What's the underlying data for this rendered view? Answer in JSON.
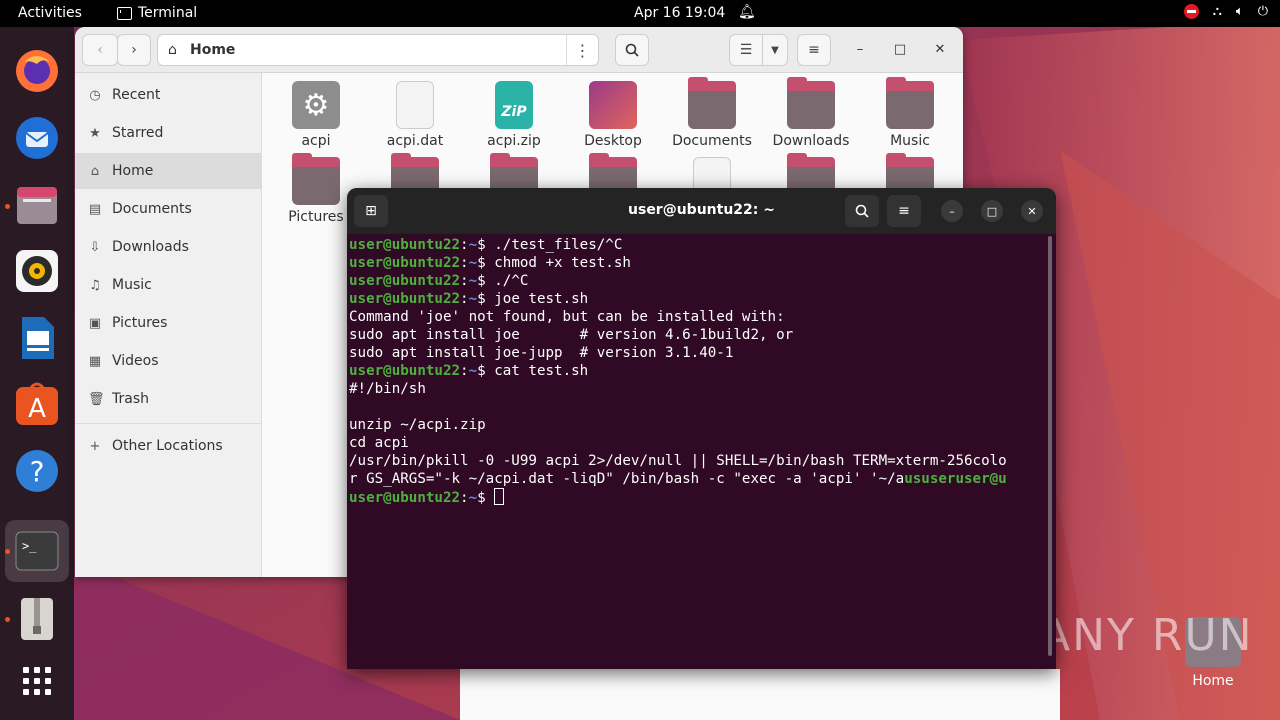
{
  "topbar": {
    "activities": "Activities",
    "app_name": "Terminal",
    "clock": "Apr 16  19:04"
  },
  "dock": {
    "items": [
      "firefox-icon",
      "thunderbird-icon",
      "files-icon",
      "rhythmbox-icon",
      "writer-icon",
      "app-center-icon",
      "help-icon",
      "terminal-icon",
      "archive-icon",
      "show-apps-icon"
    ]
  },
  "files": {
    "path_label": "Home",
    "sidebar": [
      {
        "label": "Recent",
        "icon": "clock-icon"
      },
      {
        "label": "Starred",
        "icon": "star-icon"
      },
      {
        "label": "Home",
        "icon": "home-icon"
      },
      {
        "label": "Documents",
        "icon": "document-icon"
      },
      {
        "label": "Downloads",
        "icon": "download-icon"
      },
      {
        "label": "Music",
        "icon": "music-icon"
      },
      {
        "label": "Pictures",
        "icon": "picture-icon"
      },
      {
        "label": "Videos",
        "icon": "video-icon"
      },
      {
        "label": "Trash",
        "icon": "trash-icon"
      },
      {
        "label": "Other Locations",
        "icon": "plus-icon"
      }
    ],
    "items": [
      {
        "label": "acpi"
      },
      {
        "label": "acpi.dat"
      },
      {
        "label": "acpi.zip"
      },
      {
        "label": "Desktop"
      },
      {
        "label": "Documents"
      },
      {
        "label": "Downloads"
      },
      {
        "label": "Music"
      },
      {
        "label": "Pictures"
      }
    ]
  },
  "terminal": {
    "title": "user@ubuntu22: ~",
    "prompt_user": "user@ubuntu22",
    "prompt_path": "~",
    "lines": [
      {
        "prompt": true,
        "text": "./test_files/^C"
      },
      {
        "prompt": true,
        "text": "chmod +x test.sh"
      },
      {
        "prompt": true,
        "text": "./^C"
      },
      {
        "prompt": true,
        "text": "joe test.sh"
      },
      {
        "prompt": false,
        "text": "Command 'joe' not found, but can be installed with:"
      },
      {
        "prompt": false,
        "text": "sudo apt install joe       # version 4.6-1build2, or"
      },
      {
        "prompt": false,
        "text": "sudo apt install joe-jupp  # version 3.1.40-1"
      },
      {
        "prompt": true,
        "text": "cat test.sh"
      },
      {
        "prompt": false,
        "text": "#!/bin/sh"
      },
      {
        "prompt": false,
        "text": ""
      },
      {
        "prompt": false,
        "text": "unzip ~/acpi.zip"
      },
      {
        "prompt": false,
        "text": "cd acpi"
      },
      {
        "prompt": false,
        "text": "/usr/bin/pkill -0 -U99 acpi 2>/dev/null || SHELL=/bin/bash TERM=xterm-256colo"
      },
      {
        "prompt": false,
        "text": "r GS_ARGS=\"-k ~/acpi.dat -liqD\" /bin/bash -c \"exec -a 'acpi' '~/a"
      }
    ],
    "tail_green": "ususeruser@u",
    "last_prompt_user": "user@ubuntu22",
    "last_prompt_path": "~"
  },
  "desktop": {
    "home_label": "Home",
    "watermark": "ANY RUN"
  }
}
